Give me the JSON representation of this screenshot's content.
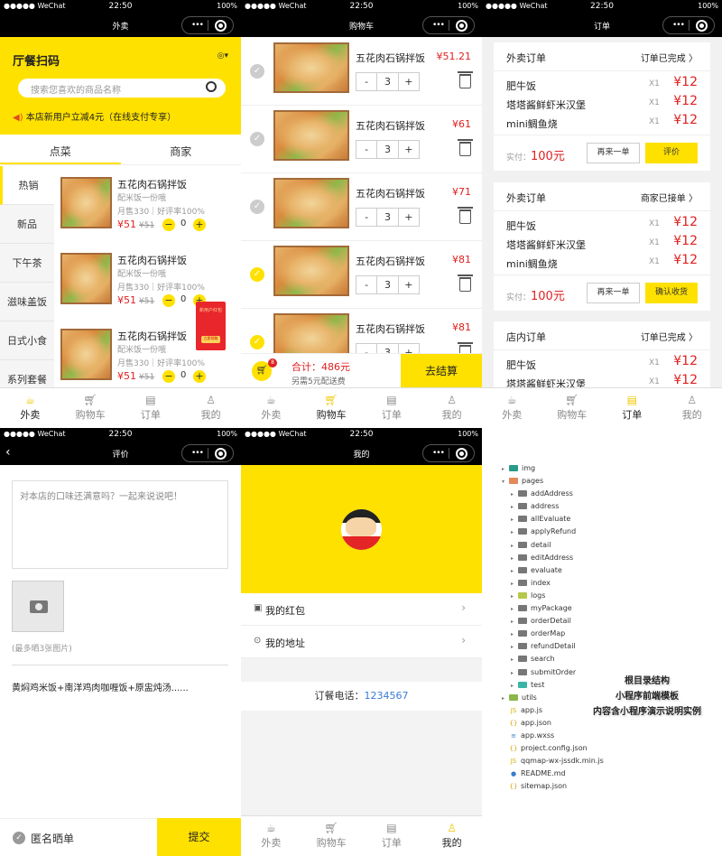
{
  "status": {
    "carrier": "●●●●● WeChat",
    "time": "22:50",
    "battery": "100%"
  },
  "tabs": [
    "外卖",
    "购物车",
    "订单",
    "我的"
  ],
  "p1": {
    "title": "外卖",
    "store": "厅餐扫码",
    "search_placeholder": "搜索您喜欢的商品名称",
    "promo": "本店新用户立减4元（在线支付专享）",
    "segments": [
      "点菜",
      "商家"
    ],
    "categories": [
      "热销",
      "新品",
      "下午茶",
      "滋味盖饭",
      "日式小食",
      "系列套餐"
    ],
    "items": [
      {
        "name": "五花肉石锅拌饭",
        "sub": "配米饭一份哦",
        "stat": "月售330｜好评率100%",
        "price": "¥51",
        "old": "¥51",
        "qty": "0"
      },
      {
        "name": "五花肉石锅拌饭",
        "sub": "配米饭一份哦",
        "stat": "月售330｜好评率100%",
        "price": "¥51",
        "old": "¥51",
        "qty": "0"
      },
      {
        "name": "五花肉石锅拌饭",
        "sub": "配米饭一份哦",
        "stat": "月售330｜好评率100%",
        "price": "¥51",
        "old": "¥51",
        "qty": "0"
      }
    ],
    "redpack": {
      "top": "新用户红包",
      "btn": "立即领取"
    }
  },
  "p2": {
    "title": "购物车",
    "rows": [
      {
        "name": "五花肉石锅拌饭",
        "price": "¥51.21",
        "qty": "3",
        "checked": false
      },
      {
        "name": "五花肉石锅拌饭",
        "price": "¥61",
        "qty": "3",
        "checked": false
      },
      {
        "name": "五花肉石锅拌饭",
        "price": "¥71",
        "qty": "3",
        "checked": false
      },
      {
        "name": "五花肉石锅拌饭",
        "price": "¥81",
        "qty": "3",
        "checked": true
      },
      {
        "name": "五花肉石锅拌饭",
        "price": "¥81",
        "qty": "3",
        "checked": true
      }
    ],
    "badge": "8",
    "total": "合计：486元",
    "delivery": "另需5元配送费",
    "pay": "去结算"
  },
  "p3": {
    "title": "订单",
    "orders": [
      {
        "type": "外卖订单",
        "status": "订单已完成 〉",
        "lines": [
          {
            "n": "肥牛饭",
            "q": "X1",
            "p": "¥12"
          },
          {
            "n": "塔塔酱鲜虾米汉堡",
            "q": "X1",
            "p": "¥12"
          },
          {
            "n": "mini鲷鱼烧",
            "q": "X1",
            "p": "¥12"
          }
        ],
        "paid_label": "实付：",
        "paid": "100元",
        "b1": "再来一单",
        "b2": "评价"
      },
      {
        "type": "外卖订单",
        "status": "商家已接单 〉",
        "lines": [
          {
            "n": "肥牛饭",
            "q": "X1",
            "p": "¥12"
          },
          {
            "n": "塔塔酱鲜虾米汉堡",
            "q": "X1",
            "p": "¥12"
          },
          {
            "n": "mini鲷鱼烧",
            "q": "X1",
            "p": "¥12"
          }
        ],
        "paid_label": "实付：",
        "paid": "100元",
        "b1": "再来一单",
        "b2": "确认收货"
      },
      {
        "type": "店内订单",
        "status": "订单已完成 〉",
        "lines": [
          {
            "n": "肥牛饭",
            "q": "X1",
            "p": "¥12"
          },
          {
            "n": "塔塔酱鲜虾米汉堡",
            "q": "X1",
            "p": "¥12"
          }
        ]
      }
    ]
  },
  "p4": {
    "title": "评价",
    "placeholder": "对本店的口味还满意吗？一起来说说吧！",
    "limit": "(最多晒3张图片)",
    "combo": "黄焖鸡米饭+南洋鸡肉咖喱饭+原盅炖汤......",
    "anon": "匿名晒单",
    "submit": "提交"
  },
  "p5": {
    "title": "我的",
    "menu": [
      "我的红包",
      "我的地址"
    ],
    "phone_label": "订餐电话：",
    "phone": "1234567"
  },
  "p6": {
    "tree": [
      {
        "t": "img",
        "type": "folder",
        "cls": "img",
        "lvl": 0,
        "arr": "▸"
      },
      {
        "t": "pages",
        "type": "folder",
        "cls": "pg",
        "lvl": 0,
        "arr": "▾"
      },
      {
        "t": "addAddress",
        "type": "folder",
        "lvl": 1,
        "arr": "▸"
      },
      {
        "t": "address",
        "type": "folder",
        "lvl": 1,
        "arr": "▸"
      },
      {
        "t": "allEvaluate",
        "type": "folder",
        "lvl": 1,
        "arr": "▸"
      },
      {
        "t": "applyRefund",
        "type": "folder",
        "lvl": 1,
        "arr": "▸"
      },
      {
        "t": "detail",
        "type": "folder",
        "lvl": 1,
        "arr": "▸"
      },
      {
        "t": "editAddress",
        "type": "folder",
        "lvl": 1,
        "arr": "▸"
      },
      {
        "t": "evaluate",
        "type": "folder",
        "lvl": 1,
        "arr": "▸"
      },
      {
        "t": "index",
        "type": "folder",
        "lvl": 1,
        "arr": "▸"
      },
      {
        "t": "logs",
        "type": "folder",
        "cls": "lg",
        "lvl": 1,
        "arr": "▸"
      },
      {
        "t": "myPackage",
        "type": "folder",
        "lvl": 1,
        "arr": "▸"
      },
      {
        "t": "orderDetail",
        "type": "folder",
        "lvl": 1,
        "arr": "▸"
      },
      {
        "t": "orderMap",
        "type": "folder",
        "lvl": 1,
        "arr": "▸"
      },
      {
        "t": "refundDetail",
        "type": "folder",
        "lvl": 1,
        "arr": "▸"
      },
      {
        "t": "search",
        "type": "folder",
        "lvl": 1,
        "arr": "▸"
      },
      {
        "t": "submitOrder",
        "type": "folder",
        "lvl": 1,
        "arr": "▸"
      },
      {
        "t": "test",
        "type": "folder",
        "cls": "ts",
        "lvl": 1,
        "arr": "▸"
      },
      {
        "t": "utils",
        "type": "folder",
        "cls": "ut",
        "lvl": 0,
        "arr": "▸"
      },
      {
        "t": "app.js",
        "type": "file",
        "icon": "JS",
        "color": "#d4b100",
        "lvl": 0
      },
      {
        "t": "app.json",
        "type": "file",
        "icon": "{}",
        "color": "#d4a000",
        "lvl": 0
      },
      {
        "t": "app.wxss",
        "type": "file",
        "icon": "≡",
        "color": "#3a7ad0",
        "lvl": 0
      },
      {
        "t": "project.config.json",
        "type": "file",
        "icon": "{}",
        "color": "#d4a000",
        "lvl": 0
      },
      {
        "t": "qqmap-wx-jssdk.min.js",
        "type": "file",
        "icon": "JS",
        "color": "#d4b100",
        "lvl": 0
      },
      {
        "t": "README.md",
        "type": "file",
        "icon": "●",
        "color": "#3a7ad0",
        "lvl": 0
      },
      {
        "t": "sitemap.json",
        "type": "file",
        "icon": "{}",
        "color": "#d4a000",
        "lvl": 0
      }
    ],
    "note": [
      "根目录结构",
      "小程序前端模板",
      "内容含小程序演示说明实例"
    ]
  },
  "colors": {
    "accent": "#ffe100",
    "price": "#e02020",
    "link": "#3b7ad9"
  }
}
